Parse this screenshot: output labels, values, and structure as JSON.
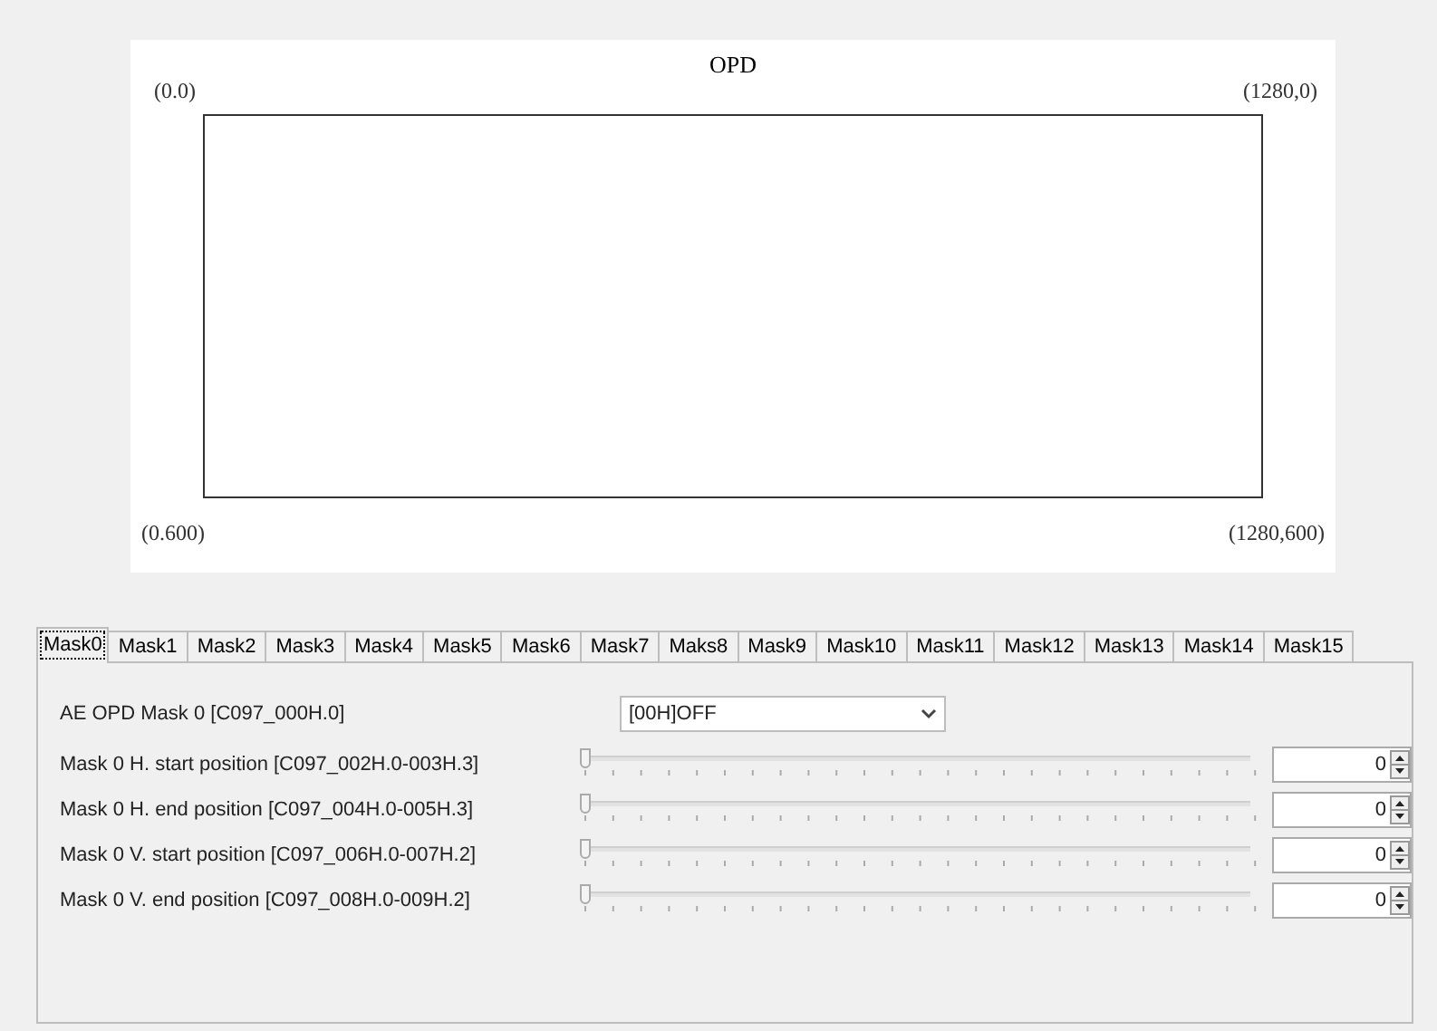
{
  "canvas": {
    "title": "OPD",
    "corner_top_left": "(0.0)",
    "corner_top_right": "(1280,0)",
    "corner_bottom_left": "(0.600)",
    "corner_bottom_right": "(1280,600)"
  },
  "tabs": [
    {
      "label": "Mask0",
      "selected": true
    },
    {
      "label": "Mask1",
      "selected": false
    },
    {
      "label": "Mask2",
      "selected": false
    },
    {
      "label": "Mask3",
      "selected": false
    },
    {
      "label": "Mask4",
      "selected": false
    },
    {
      "label": "Mask5",
      "selected": false
    },
    {
      "label": "Mask6",
      "selected": false
    },
    {
      "label": "Mask7",
      "selected": false
    },
    {
      "label": "Maks8",
      "selected": false
    },
    {
      "label": "Mask9",
      "selected": false
    },
    {
      "label": "Mask10",
      "selected": false
    },
    {
      "label": "Mask11",
      "selected": false
    },
    {
      "label": "Mask12",
      "selected": false
    },
    {
      "label": "Mask13",
      "selected": false
    },
    {
      "label": "Mask14",
      "selected": false
    },
    {
      "label": "Mask15",
      "selected": false
    }
  ],
  "settings": [
    {
      "kind": "dropdown",
      "label": "AE OPD Mask 0 [C097_000H.0]",
      "value": "[00H]OFF"
    },
    {
      "kind": "slider",
      "label": "Mask 0 H. start position [C097_002H.0-003H.3]",
      "level": 0,
      "value": "0"
    },
    {
      "kind": "slider",
      "label": "Mask 0 H. end position [C097_004H.0-005H.3]",
      "level": 0,
      "value": "0"
    },
    {
      "kind": "slider",
      "label": "Mask 0 V. start position [C097_006H.0-007H.2]",
      "level": 0,
      "value": "0"
    },
    {
      "kind": "slider",
      "label": "Mask 0 V. end position [C097_008H.0-009H.2]",
      "level": 0,
      "value": "0"
    }
  ]
}
